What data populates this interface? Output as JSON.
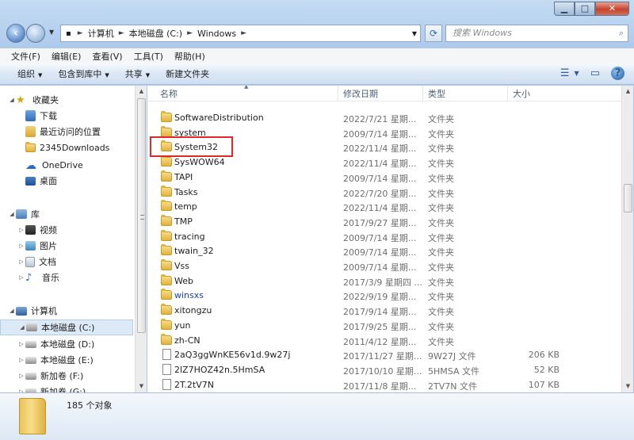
{
  "address": {
    "crumbs": [
      "计算机",
      "本地磁盘 (C:)",
      "Windows"
    ]
  },
  "search": {
    "placeholder": "搜索 Windows"
  },
  "menu": [
    "文件(F)",
    "编辑(E)",
    "查看(V)",
    "工具(T)",
    "帮助(H)"
  ],
  "commands": [
    {
      "label": "组织",
      "has_dropdown": true
    },
    {
      "label": "包含到库中",
      "has_dropdown": true
    },
    {
      "label": "共享",
      "has_dropdown": true
    },
    {
      "label": "新建文件夹",
      "has_dropdown": false
    }
  ],
  "nav": {
    "favorites": {
      "label": "收藏夹",
      "items": [
        "下载",
        "最近访问的位置",
        "2345Downloads"
      ]
    },
    "onedrive": "OneDrive",
    "desktop": "桌面",
    "libraries": {
      "label": "库",
      "items": [
        "视频",
        "图片",
        "文档",
        "音乐"
      ]
    },
    "computer": {
      "label": "计算机",
      "items": [
        "本地磁盘 (C:)",
        "本地磁盘 (D:)",
        "本地磁盘 (E:)",
        "新加卷 (F:)",
        "新加卷 (G:)"
      ]
    }
  },
  "columns": {
    "name": "名称",
    "date": "修改日期",
    "type": "类型",
    "size": "大小"
  },
  "files": [
    {
      "name": "SoftwareDistribution",
      "date": "2022/7/21 星期...",
      "type": "文件夹",
      "size": "",
      "kind": "folder"
    },
    {
      "name": "system",
      "date": "2009/7/14 星期...",
      "type": "文件夹",
      "size": "",
      "kind": "folder"
    },
    {
      "name": "System32",
      "date": "2022/11/4 星期...",
      "type": "文件夹",
      "size": "",
      "kind": "folder"
    },
    {
      "name": "SysWOW64",
      "date": "2022/11/4 星期...",
      "type": "文件夹",
      "size": "",
      "kind": "folder"
    },
    {
      "name": "TAPI",
      "date": "2009/7/14 星期...",
      "type": "文件夹",
      "size": "",
      "kind": "folder"
    },
    {
      "name": "Tasks",
      "date": "2022/7/20 星期...",
      "type": "文件夹",
      "size": "",
      "kind": "folder"
    },
    {
      "name": "temp",
      "date": "2022/11/4 星期...",
      "type": "文件夹",
      "size": "",
      "kind": "folder"
    },
    {
      "name": "TMP",
      "date": "2017/9/27 星期...",
      "type": "文件夹",
      "size": "",
      "kind": "folder"
    },
    {
      "name": "tracing",
      "date": "2009/7/14 星期...",
      "type": "文件夹",
      "size": "",
      "kind": "folder"
    },
    {
      "name": "twain_32",
      "date": "2009/7/14 星期...",
      "type": "文件夹",
      "size": "",
      "kind": "folder"
    },
    {
      "name": "Vss",
      "date": "2009/7/14 星期...",
      "type": "文件夹",
      "size": "",
      "kind": "folder"
    },
    {
      "name": "Web",
      "date": "2017/3/9 星期四 ...",
      "type": "文件夹",
      "size": "",
      "kind": "folder"
    },
    {
      "name": "winsxs",
      "date": "2022/9/19 星期...",
      "type": "文件夹",
      "size": "",
      "kind": "folder",
      "blue": true
    },
    {
      "name": "xitongzu",
      "date": "2017/9/14 星期...",
      "type": "文件夹",
      "size": "",
      "kind": "folder"
    },
    {
      "name": "yun",
      "date": "2017/9/25 星期...",
      "type": "文件夹",
      "size": "",
      "kind": "folder"
    },
    {
      "name": "zh-CN",
      "date": "2011/4/12 星期...",
      "type": "文件夹",
      "size": "",
      "kind": "folder"
    },
    {
      "name": "2aQ3ggWnKE56v1d.9w27j",
      "date": "2017/11/27 星期...",
      "type": "9W27J 文件",
      "size": "206 KB",
      "kind": "file"
    },
    {
      "name": "2lZ7HOZ42n.5HmSA",
      "date": "2017/10/10 星期...",
      "type": "5HMSA 文件",
      "size": "52 KB",
      "kind": "file"
    },
    {
      "name": "2T.2tV7N",
      "date": "2017/11/8 星期...",
      "type": "2TV7N 文件",
      "size": "107 KB",
      "kind": "file"
    }
  ],
  "status": {
    "count": "185 个对象"
  },
  "colors": {
    "highlight_box": "#e02a2a",
    "folder": "#e3b23c",
    "selection": "#dce9f7"
  }
}
